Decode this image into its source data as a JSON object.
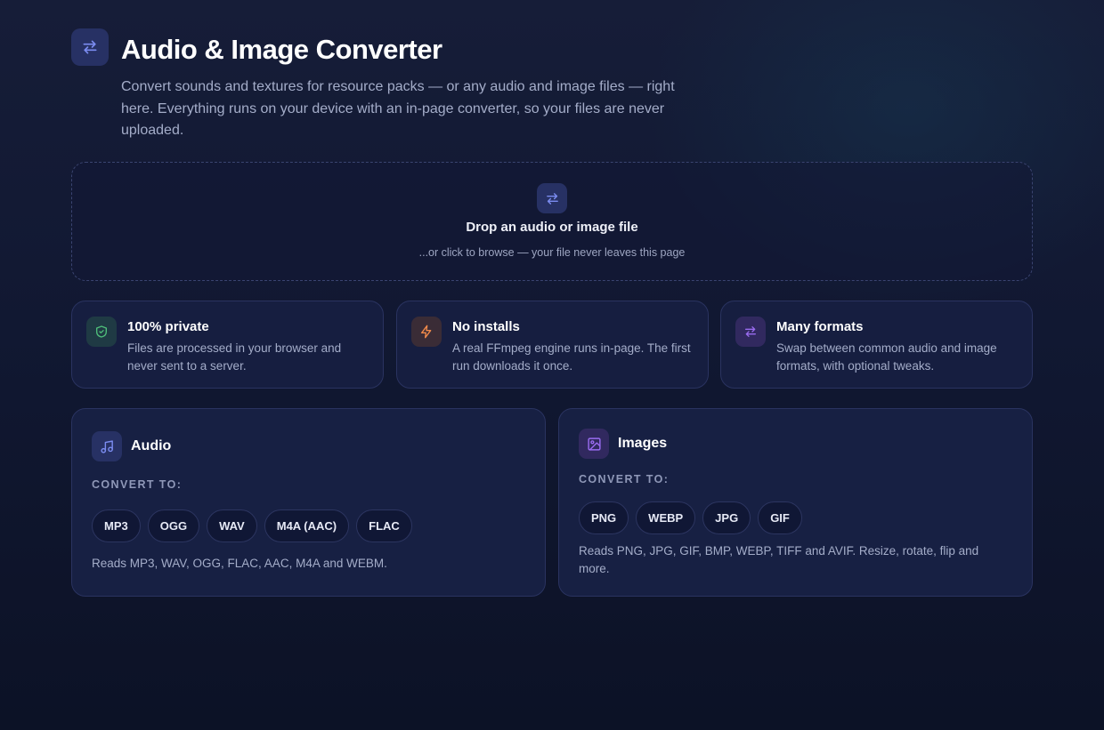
{
  "header": {
    "icon": "swap-arrows-icon",
    "title": "Audio & Image Converter",
    "subtitle": "Convert sounds and textures for resource packs — or any audio and image files — right here. Everything runs on your device with an in-page converter, so your files are never uploaded."
  },
  "dropzone": {
    "icon": "swap-arrows-icon",
    "title": "Drop an audio or image file",
    "subtitle": "...or click to browse — your file never leaves this page"
  },
  "features": [
    {
      "icon": "shield-check-icon",
      "title": "100% private",
      "description": "Files are processed in your browser and never sent to a server.",
      "color": "#4fbf7a"
    },
    {
      "icon": "lightning-icon",
      "title": "No installs",
      "description": "A real FFmpeg engine runs in-page. The first run downloads it once.",
      "color": "#f08a4b"
    },
    {
      "icon": "swap-arrows-icon",
      "title": "Many formats",
      "description": "Swap between common audio and image formats, with optional tweaks.",
      "color": "#9a6cf0"
    }
  ],
  "audio": {
    "icon": "music-note-icon",
    "title": "Audio",
    "convert_label": "CONVERT TO:",
    "formats": [
      "MP3",
      "OGG",
      "WAV",
      "M4A (AAC)",
      "FLAC"
    ],
    "note": "Reads MP3, WAV, OGG, FLAC, AAC, M4A and WEBM."
  },
  "images": {
    "icon": "image-icon",
    "title": "Images",
    "convert_label": "CONVERT TO:",
    "formats": [
      "PNG",
      "WEBP",
      "JPG",
      "GIF"
    ],
    "note": "Reads PNG, JPG, GIF, BMP, WEBP, TIFF and AVIF. Resize, rotate, flip and more."
  },
  "colors": {
    "accent": "#7b8cf0",
    "green": "#4fbf7a",
    "orange": "#f08a4b",
    "purple": "#9a6cf0"
  }
}
